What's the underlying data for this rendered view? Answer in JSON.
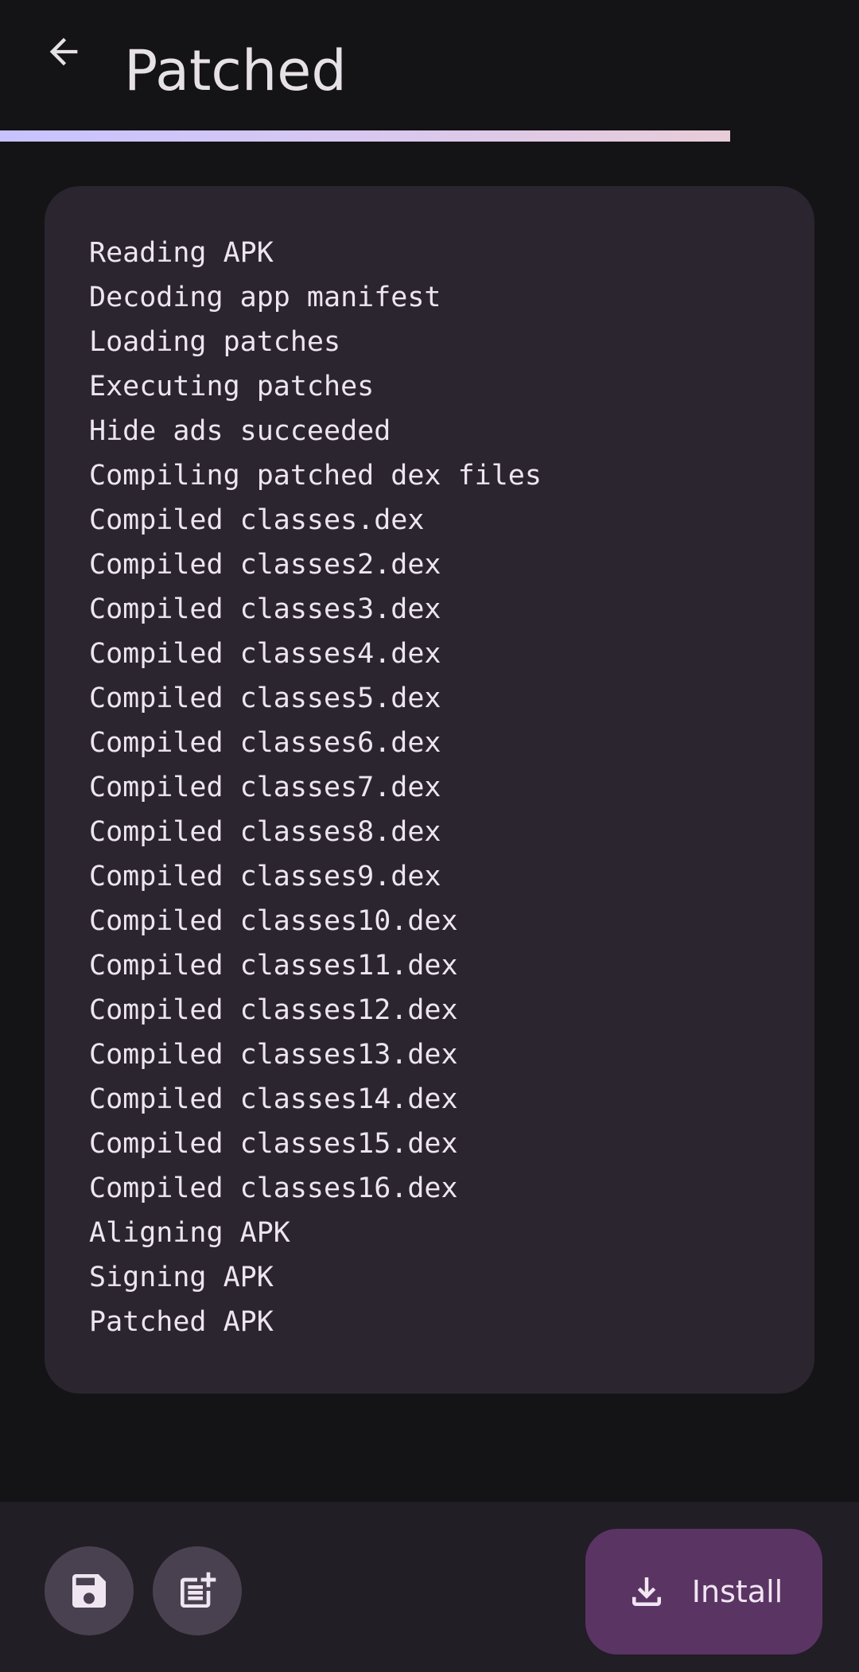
{
  "header": {
    "title": "Patched",
    "back_icon": "arrow-back-icon"
  },
  "progress": {
    "fraction": 0.85,
    "colors": [
      "#c7c3ff",
      "#e8ccd8"
    ]
  },
  "log": {
    "lines": [
      "Reading APK",
      "Decoding app manifest",
      "Loading patches",
      "Executing patches",
      "Hide ads succeeded",
      "Compiling patched dex files",
      "Compiled classes.dex",
      "Compiled classes2.dex",
      "Compiled classes3.dex",
      "Compiled classes4.dex",
      "Compiled classes5.dex",
      "Compiled classes6.dex",
      "Compiled classes7.dex",
      "Compiled classes8.dex",
      "Compiled classes9.dex",
      "Compiled classes10.dex",
      "Compiled classes11.dex",
      "Compiled classes12.dex",
      "Compiled classes13.dex",
      "Compiled classes14.dex",
      "Compiled classes15.dex",
      "Compiled classes16.dex",
      "Aligning APK",
      "Signing APK",
      "Patched APK"
    ]
  },
  "bottom_bar": {
    "save_icon": "save-icon",
    "export_log_icon": "post-add-icon",
    "install_icon": "download-icon",
    "install_label": "Install"
  },
  "colors": {
    "background": "#141316",
    "card": "#2b2530",
    "bottom_bar": "#211e25",
    "round_button": "#4a4150",
    "install_button": "#5a3463"
  }
}
